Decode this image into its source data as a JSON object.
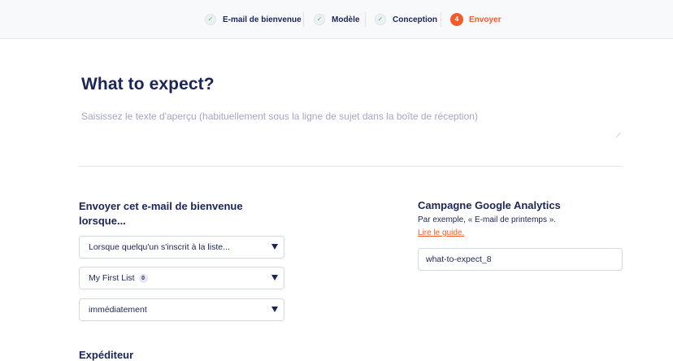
{
  "steps": [
    {
      "label": "E-mail de bienvenue",
      "state": "done",
      "marker": "✓"
    },
    {
      "label": "Modèle",
      "state": "done",
      "marker": "✓"
    },
    {
      "label": "Conception",
      "state": "done",
      "marker": "✓"
    },
    {
      "label": "Envoyer",
      "state": "active",
      "marker": "4"
    }
  ],
  "preview": {
    "title": "What to expect?",
    "placeholder": "Saisissez le texte d'aperçu (habituellement sous la ligne de sujet dans la boîte de réception)"
  },
  "trigger": {
    "label": "Envoyer cet e-mail de bienvenue lorsque...",
    "condition_value": "Lorsque quelqu'un s'inscrit à la liste...",
    "list_value": "My First List",
    "list_count": "0",
    "timing_value": "immédiatement"
  },
  "sender": {
    "label": "Expéditeur"
  },
  "analytics": {
    "title": "Campagne Google Analytics",
    "hint": "Par exemple, « E-mail de printemps ».",
    "guide_link": "Lire le guide.",
    "campaign_value": "what-to-expect_8"
  },
  "colors": {
    "accent": "#f35b2b",
    "text": "#1b2556",
    "check": "#45b45d"
  }
}
